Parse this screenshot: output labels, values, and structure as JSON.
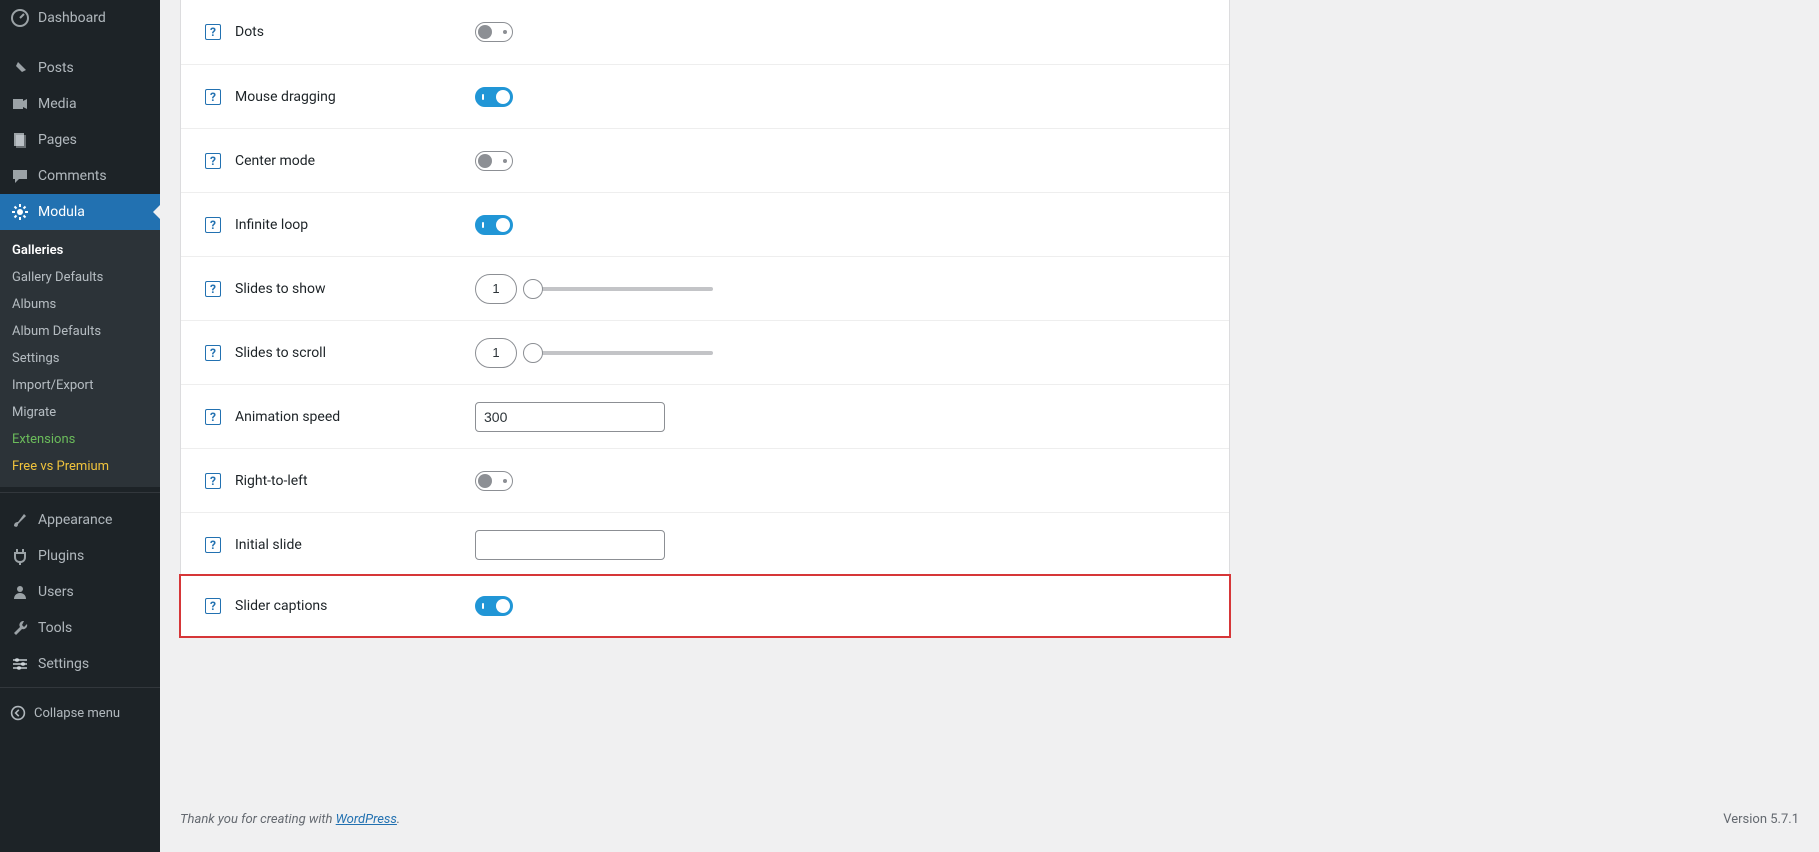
{
  "sidebar": {
    "items": [
      {
        "label": "Dashboard",
        "icon": "dashboard"
      },
      {
        "label": "Posts",
        "icon": "pin"
      },
      {
        "label": "Media",
        "icon": "media"
      },
      {
        "label": "Pages",
        "icon": "pages"
      },
      {
        "label": "Comments",
        "icon": "comment"
      },
      {
        "label": "Modula",
        "icon": "modula",
        "current": true
      }
    ],
    "submenu": [
      {
        "label": "Galleries",
        "active": true
      },
      {
        "label": "Gallery Defaults"
      },
      {
        "label": "Albums"
      },
      {
        "label": "Album Defaults"
      },
      {
        "label": "Settings"
      },
      {
        "label": "Import/Export"
      },
      {
        "label": "Migrate"
      },
      {
        "label": "Extensions",
        "ext": true
      },
      {
        "label": "Free vs Premium",
        "premium": true
      }
    ],
    "items2": [
      {
        "label": "Appearance",
        "icon": "brush"
      },
      {
        "label": "Plugins",
        "icon": "plug"
      },
      {
        "label": "Users",
        "icon": "user"
      },
      {
        "label": "Tools",
        "icon": "wrench"
      },
      {
        "label": "Settings",
        "icon": "sliders"
      }
    ],
    "collapse": "Collapse menu"
  },
  "settings": {
    "help_glyph": "?",
    "rows": [
      {
        "key": "dots",
        "label": "Dots",
        "type": "toggle",
        "value": false
      },
      {
        "key": "mouse_dragging",
        "label": "Mouse dragging",
        "type": "toggle",
        "value": true
      },
      {
        "key": "center_mode",
        "label": "Center mode",
        "type": "toggle",
        "value": false
      },
      {
        "key": "infinite_loop",
        "label": "Infinite loop",
        "type": "toggle",
        "value": true
      },
      {
        "key": "slides_to_show",
        "label": "Slides to show",
        "type": "slider",
        "value": 1
      },
      {
        "key": "slides_to_scroll",
        "label": "Slides to scroll",
        "type": "slider",
        "value": 1
      },
      {
        "key": "animation_speed",
        "label": "Animation speed",
        "type": "text",
        "value": "300"
      },
      {
        "key": "right_to_left",
        "label": "Right-to-left",
        "type": "toggle",
        "value": false
      },
      {
        "key": "initial_slide",
        "label": "Initial slide",
        "type": "text",
        "value": ""
      },
      {
        "key": "slider_captions",
        "label": "Slider captions",
        "type": "toggle",
        "value": true,
        "highlight": true
      }
    ]
  },
  "footer": {
    "thanks_prefix": "Thank you for creating with ",
    "link_text": "WordPress",
    "thanks_suffix": ".",
    "version": "Version 5.7.1"
  }
}
